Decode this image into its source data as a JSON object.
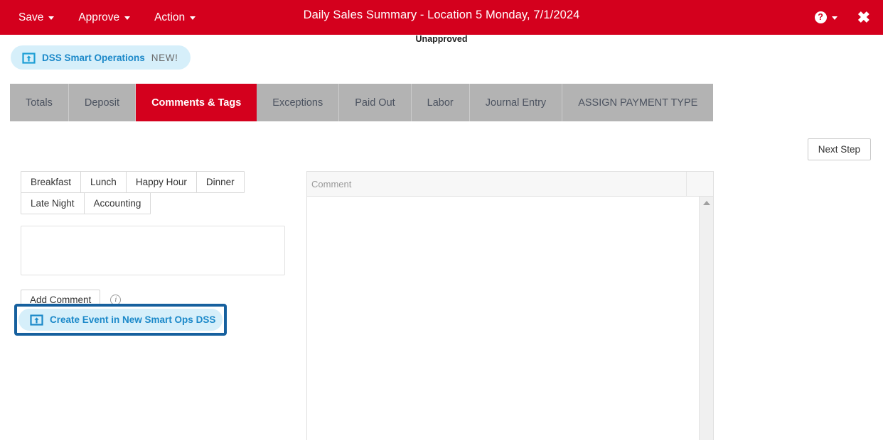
{
  "header": {
    "title": "Daily Sales Summary - Location 5 Monday, 7/1/2024",
    "status": "Unapproved",
    "accent_red": "#d4001d",
    "menus": [
      {
        "label": "Save",
        "icon": "chevron-down-icon"
      },
      {
        "label": "Approve",
        "icon": "chevron-down-icon"
      },
      {
        "label": "Action",
        "icon": "chevron-down-icon"
      }
    ],
    "help": {
      "glyph": "?",
      "icon": "help-circle-icon"
    },
    "close": {
      "glyph": "✖",
      "icon": "close-icon"
    }
  },
  "dss_badge": {
    "label": "DSS Smart Operations",
    "new_tag": "NEW!",
    "icon": "open-in-new-icon",
    "bg": "#d6effa",
    "text_color": "#1c89c9"
  },
  "tabs": [
    {
      "label": "Totals",
      "active": false
    },
    {
      "label": "Deposit",
      "active": false
    },
    {
      "label": "Comments & Tags",
      "active": true
    },
    {
      "label": "Exceptions",
      "active": false
    },
    {
      "label": "Paid Out",
      "active": false
    },
    {
      "label": "Labor",
      "active": false
    },
    {
      "label": "Journal Entry",
      "active": false
    },
    {
      "label": "ASSIGN PAYMENT TYPE",
      "active": false
    }
  ],
  "toolbar": {
    "next_step_label": "Next Step"
  },
  "tags": {
    "row1": [
      "Breakfast",
      "Lunch",
      "Happy Hour",
      "Dinner"
    ],
    "row2": [
      "Late Night",
      "Accounting"
    ]
  },
  "comment_form": {
    "textarea_value": "",
    "textarea_placeholder": "",
    "add_comment_label": "Add Comment",
    "info_glyph": "i"
  },
  "create_event": {
    "label": "Create Event in New Smart Ops DSS",
    "icon": "open-in-new-icon",
    "focus_border_color": "#16609e",
    "pill_bg": "#d6effa",
    "text_color": "#1c89c9"
  },
  "comment_grid": {
    "column_header": "Comment",
    "rows": [],
    "scrollbar": {
      "arrow_icon": "scroll-up-arrow-icon"
    }
  }
}
